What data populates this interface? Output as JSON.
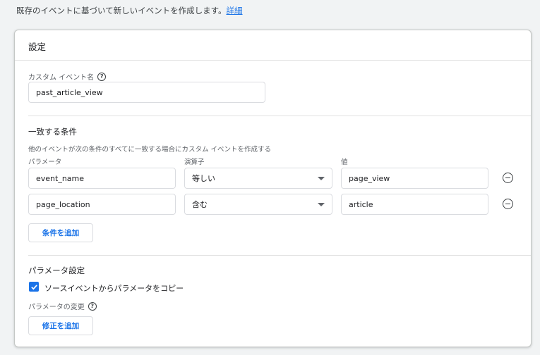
{
  "intro": {
    "text": "既存のイベントに基づいて新しいイベントを作成します。",
    "link": "詳細"
  },
  "card": {
    "title": "設定"
  },
  "custom_event": {
    "label": "カスタム イベント名",
    "value": "past_article_view"
  },
  "conditions": {
    "title": "一致する条件",
    "description": "他のイベントが次の条件のすべてに一致する場合にカスタム イベントを作成する",
    "col_param": "パラメータ",
    "col_operator": "演算子",
    "col_value": "値",
    "rows": [
      {
        "param": "event_name",
        "operator": "等しい",
        "value": "page_view"
      },
      {
        "param": "page_location",
        "operator": "含む",
        "value": "article"
      }
    ],
    "add_label": "条件を追加"
  },
  "params": {
    "title": "パラメータ設定",
    "copy_label": "ソースイベントからパラメータをコピー",
    "copy_checked": true,
    "modify_label": "パラメータの変更",
    "add_modify_label": "修正を追加"
  },
  "colors": {
    "accent": "#1a73e8",
    "border": "#dadce0",
    "text": "#202124",
    "muted": "#5f6368"
  }
}
